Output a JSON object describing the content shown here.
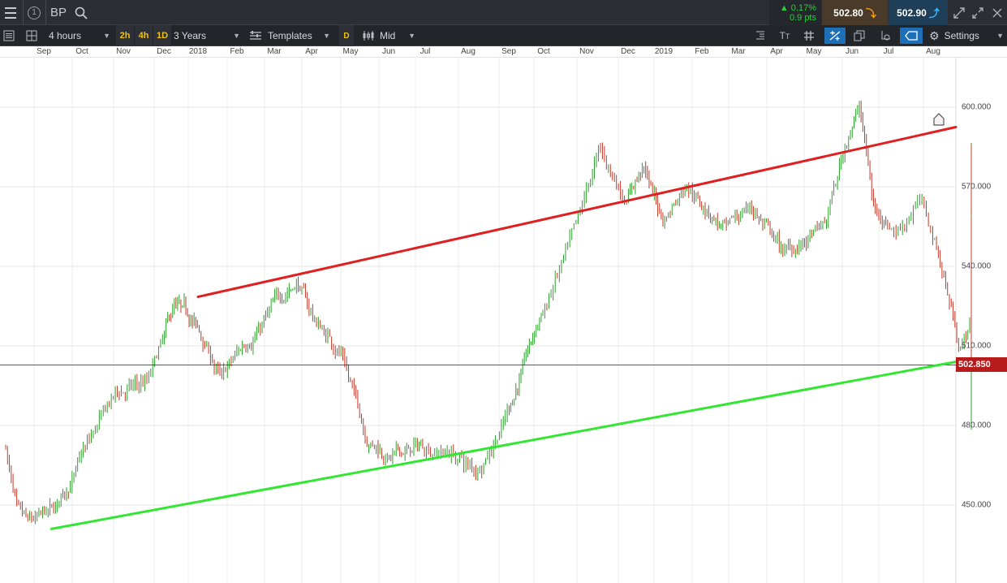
{
  "topbar": {
    "symbol": "BP",
    "change_pct": "▲ 0.17%",
    "change_pts": "0.9 pts",
    "sell_price": "502.80",
    "buy_price": "502.90"
  },
  "toolbar": {
    "interval": "4 hours",
    "quick_intervals": [
      "2h",
      "4h",
      "1D"
    ],
    "range": "3 Years",
    "templates_label": "Templates",
    "price_type_badge": "D",
    "price_type": "Mid",
    "settings_label": "Settings"
  },
  "time_axis": [
    "Sep",
    "Oct",
    "Nov",
    "Dec",
    "2018",
    "Feb",
    "Mar",
    "Apr",
    "May",
    "Jun",
    "Jul",
    "Aug",
    "Sep",
    "Oct",
    "Nov",
    "Dec",
    "2019",
    "Feb",
    "Mar",
    "Apr",
    "May",
    "Jun",
    "Jul",
    "Aug"
  ],
  "colors": {
    "up_candle": "#2ca02c",
    "down_candle": "#c0392b",
    "resistance_line": "#e02020",
    "support_line": "#33e633",
    "current_price_bg": "#b71c1c",
    "buy_bg": "#1f3e57",
    "sell_bg": "#4a3a2a"
  },
  "chart_data": {
    "type": "candlestick",
    "instrument": "BP",
    "price_axis": {
      "ticks": [
        "600.000",
        "570.000",
        "540.000",
        "510.000",
        "480.000",
        "450.000"
      ],
      "range": [
        431,
        630
      ]
    },
    "current_price": "502.850",
    "x_months": [
      "Sep",
      "Oct",
      "Nov",
      "Dec",
      "2018",
      "Feb",
      "Mar",
      "Apr",
      "May",
      "Jun",
      "Jul",
      "Aug",
      "Sep",
      "Oct",
      "Nov",
      "Dec",
      "2019",
      "Feb",
      "Mar",
      "Apr",
      "May",
      "Jun",
      "Jul",
      "Aug"
    ],
    "price_path": [
      [
        0,
        472
      ],
      [
        0.3,
        446
      ],
      [
        0.6,
        441
      ],
      [
        1.3,
        447
      ],
      [
        2.3,
        477
      ],
      [
        2.8,
        491
      ],
      [
        3.6,
        496
      ],
      [
        4.3,
        524
      ],
      [
        4.9,
        518
      ],
      [
        5.6,
        497
      ],
      [
        6.1,
        508
      ],
      [
        7,
        525
      ],
      [
        7.6,
        535
      ],
      [
        8.1,
        519
      ],
      [
        8.8,
        507
      ],
      [
        9.4,
        477
      ],
      [
        10,
        468
      ],
      [
        11,
        472
      ],
      [
        11.6,
        470
      ],
      [
        12.2,
        462
      ],
      [
        12.8,
        480
      ],
      [
        13.4,
        502
      ],
      [
        14.1,
        527
      ],
      [
        14.8,
        555
      ],
      [
        15.3,
        583
      ],
      [
        15.9,
        566
      ],
      [
        16.4,
        578
      ],
      [
        17,
        557
      ],
      [
        17.6,
        573
      ],
      [
        18.1,
        562
      ],
      [
        18.7,
        553
      ],
      [
        19.3,
        563
      ],
      [
        20.2,
        545
      ],
      [
        20.8,
        549
      ],
      [
        21.3,
        555
      ],
      [
        21.9,
        590
      ],
      [
        22.2,
        601
      ],
      [
        22.6,
        562
      ],
      [
        23.2,
        554
      ],
      [
        23.7,
        566
      ],
      [
        24.2,
        541
      ],
      [
        24.7,
        510
      ],
      [
        25.2,
        526
      ],
      [
        25.8,
        513
      ],
      [
        26.5,
        497
      ],
      [
        27,
        482
      ],
      [
        27.4,
        515
      ],
      [
        28,
        512
      ],
      [
        28.4,
        498
      ],
      [
        28.8,
        530
      ],
      [
        29.2,
        546
      ],
      [
        29.8,
        540
      ],
      [
        30.3,
        532
      ],
      [
        30.9,
        558
      ],
      [
        31.4,
        548
      ],
      [
        32,
        579
      ],
      [
        32.7,
        579
      ],
      [
        33.2,
        555
      ],
      [
        33.7,
        531
      ],
      [
        34.2,
        559
      ],
      [
        34.8,
        535
      ],
      [
        35.4,
        552
      ],
      [
        35.9,
        537
      ],
      [
        36.6,
        560
      ],
      [
        37.2,
        543
      ],
      [
        37.6,
        516
      ],
      [
        37.9,
        523
      ],
      [
        38.3,
        511
      ],
      [
        38.5,
        503
      ]
    ],
    "trendlines": [
      {
        "name": "Resistance",
        "from": [
          5,
          528.5
        ],
        "to": [
          39.3,
          592.5
        ]
      },
      {
        "name": "Support",
        "from": [
          1.2,
          441
        ],
        "to": [
          39.3,
          504
        ]
      }
    ]
  }
}
